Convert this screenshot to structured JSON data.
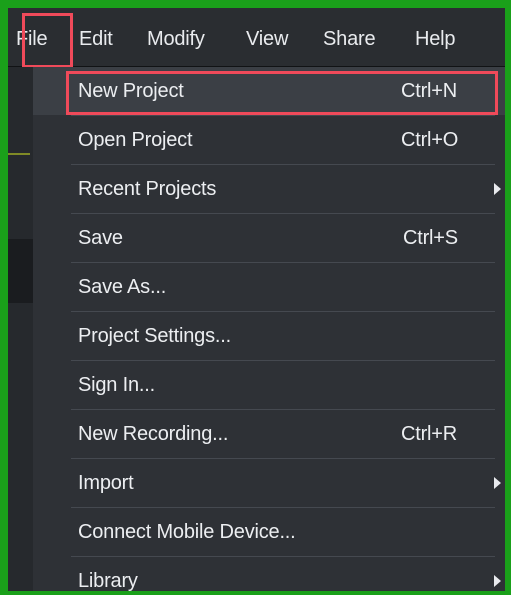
{
  "menubar": {
    "items": [
      "File",
      "Edit",
      "Modify",
      "View",
      "Share",
      "Help"
    ]
  },
  "file_menu": {
    "items": [
      {
        "label": "New Project",
        "shortcut": "Ctrl+N",
        "submenu": false
      },
      {
        "label": "Open Project",
        "shortcut": "Ctrl+O",
        "submenu": false
      },
      {
        "label": "Recent Projects",
        "shortcut": "",
        "submenu": true
      },
      {
        "label": "Save",
        "shortcut": "Ctrl+S",
        "submenu": false
      },
      {
        "label": "Save As...",
        "shortcut": "",
        "submenu": false
      },
      {
        "label": "Project Settings...",
        "shortcut": "",
        "submenu": false
      },
      {
        "label": "Sign In...",
        "shortcut": "",
        "submenu": false
      },
      {
        "label": "New Recording...",
        "shortcut": "Ctrl+R",
        "submenu": false
      },
      {
        "label": "Import",
        "shortcut": "",
        "submenu": true
      },
      {
        "label": "Connect Mobile Device...",
        "shortcut": "",
        "submenu": false
      },
      {
        "label": "Library",
        "shortcut": "",
        "submenu": true
      }
    ]
  },
  "colors": {
    "highlight_box": "#f04a5a",
    "outer_border": "#1aa01a",
    "menu_bg": "#2e3136",
    "hover_bg": "#3b3f45"
  }
}
